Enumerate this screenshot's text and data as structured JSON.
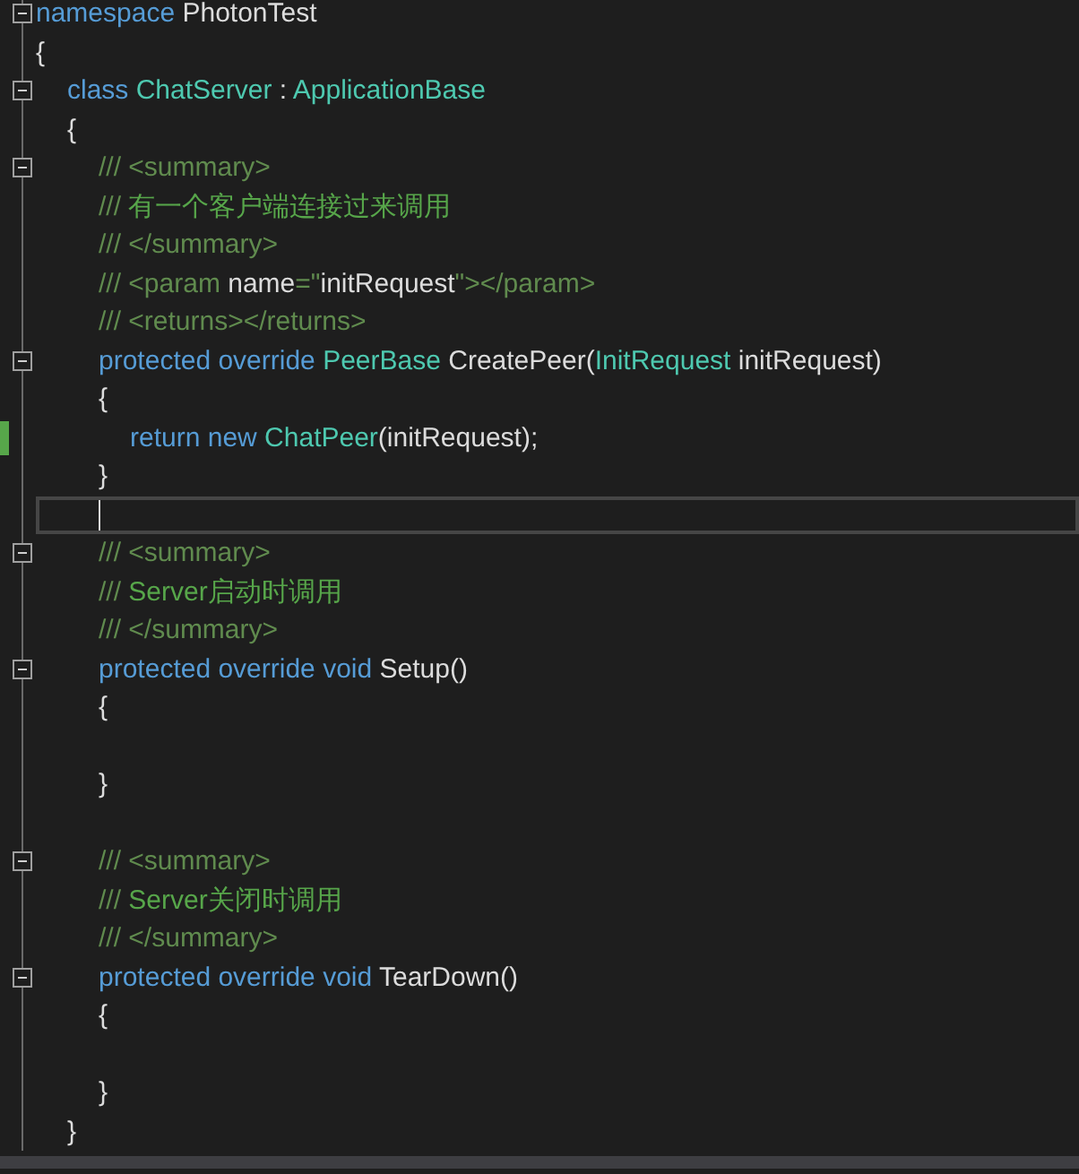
{
  "editor": {
    "lines": [
      {
        "tokens": [
          {
            "kind": "keyword",
            "text": "namespace"
          },
          {
            "kind": "plain",
            "text": " PhotonTest"
          }
        ],
        "fold": {
          "expanded": true
        },
        "changed": false,
        "current": false
      },
      {
        "tokens": [
          {
            "kind": "plain",
            "text": "{"
          }
        ],
        "changed": false,
        "current": false,
        "children": [
          {
            "tokens": [
              {
                "kind": "keyword",
                "text": "class "
              },
              {
                "kind": "type",
                "text": "ChatServer"
              },
              {
                "kind": "plain",
                "text": " : "
              },
              {
                "kind": "type",
                "text": "ApplicationBase"
              }
            ],
            "fold": {
              "expanded": true
            },
            "changed": false,
            "current": false
          },
          {
            "tokens": [
              {
                "kind": "plain",
                "text": "{"
              }
            ],
            "changed": false,
            "current": false,
            "children": [
              {
                "tokens": [
                  {
                    "kind": "doc",
                    "text": "/// <summary>"
                  }
                ],
                "fold": {
                  "expanded": true
                },
                "changed": false,
                "current": false
              },
              {
                "tokens": [
                  {
                    "kind": "doc",
                    "text": "/// "
                  },
                  {
                    "kind": "comment",
                    "text": "有一个客户端连接过来调用"
                  }
                ],
                "changed": false,
                "current": false
              },
              {
                "tokens": [
                  {
                    "kind": "doc",
                    "text": "/// </summary>"
                  }
                ],
                "changed": false,
                "current": false
              },
              {
                "tokens": [
                  {
                    "kind": "doc",
                    "text": "/// <param "
                  },
                  {
                    "kind": "plain",
                    "text": "name"
                  },
                  {
                    "kind": "doc",
                    "text": "=\""
                  },
                  {
                    "kind": "plain",
                    "text": "initRequest"
                  },
                  {
                    "kind": "doc",
                    "text": "\"></param>"
                  }
                ],
                "changed": false,
                "current": false
              },
              {
                "tokens": [
                  {
                    "kind": "doc",
                    "text": "/// <returns></returns>"
                  }
                ],
                "changed": false,
                "current": false
              },
              {
                "tokens": [
                  {
                    "kind": "keyword",
                    "text": "protected override "
                  },
                  {
                    "kind": "type",
                    "text": "PeerBase"
                  },
                  {
                    "kind": "plain",
                    "text": " CreatePeer("
                  },
                  {
                    "kind": "type",
                    "text": "InitRequest"
                  },
                  {
                    "kind": "plain",
                    "text": " initRequest)"
                  }
                ],
                "fold": {
                  "expanded": true
                },
                "changed": false,
                "current": false
              },
              {
                "tokens": [
                  {
                    "kind": "plain",
                    "text": "{"
                  }
                ],
                "changed": false,
                "current": false,
                "children": [
                  {
                    "tokens": [
                      {
                        "kind": "keyword",
                        "text": "return new "
                      },
                      {
                        "kind": "type",
                        "text": "ChatPeer"
                      },
                      {
                        "kind": "plain",
                        "text": "(initRequest);"
                      }
                    ],
                    "changed": true,
                    "current": false
                  }
                ]
              },
              {
                "tokens": [
                  {
                    "kind": "plain",
                    "text": "}"
                  }
                ],
                "changed": false,
                "current": false
              },
              {
                "changed": false,
                "current": true
              },
              {
                "tokens": [
                  {
                    "kind": "doc",
                    "text": "/// <summary>"
                  }
                ],
                "fold": {
                  "expanded": true
                },
                "changed": false,
                "current": false
              },
              {
                "tokens": [
                  {
                    "kind": "doc",
                    "text": "/// "
                  },
                  {
                    "kind": "comment",
                    "text": "Server启动时调用"
                  }
                ],
                "changed": false,
                "current": false
              },
              {
                "tokens": [
                  {
                    "kind": "doc",
                    "text": "/// </summary>"
                  }
                ],
                "changed": false,
                "current": false
              },
              {
                "tokens": [
                  {
                    "kind": "keyword",
                    "text": "protected override void"
                  },
                  {
                    "kind": "plain",
                    "text": " Setup()"
                  }
                ],
                "fold": {
                  "expanded": true
                },
                "changed": false,
                "current": false
              },
              {
                "tokens": [
                  {
                    "kind": "plain",
                    "text": "{"
                  }
                ],
                "changed": false,
                "current": false,
                "children": [
                  {
                    "changed": false,
                    "current": false
                  }
                ]
              },
              {
                "tokens": [
                  {
                    "kind": "plain",
                    "text": "}"
                  }
                ],
                "changed": false,
                "current": false
              },
              {
                "changed": false,
                "current": false
              },
              {
                "tokens": [
                  {
                    "kind": "doc",
                    "text": "/// <summary>"
                  }
                ],
                "fold": {
                  "expanded": true
                },
                "changed": false,
                "current": false
              },
              {
                "tokens": [
                  {
                    "kind": "doc",
                    "text": "/// "
                  },
                  {
                    "kind": "comment",
                    "text": "Server关闭时调用"
                  }
                ],
                "changed": false,
                "current": false
              },
              {
                "tokens": [
                  {
                    "kind": "doc",
                    "text": "/// </summary>"
                  }
                ],
                "changed": false,
                "current": false
              },
              {
                "tokens": [
                  {
                    "kind": "keyword",
                    "text": "protected override void"
                  },
                  {
                    "kind": "plain",
                    "text": " TearDown()"
                  }
                ],
                "fold": {
                  "expanded": true
                },
                "changed": false,
                "current": false
              },
              {
                "tokens": [
                  {
                    "kind": "plain",
                    "text": "{"
                  }
                ],
                "changed": false,
                "current": false,
                "children": [
                  {
                    "changed": false,
                    "current": false
                  }
                ]
              },
              {
                "tokens": [
                  {
                    "kind": "plain",
                    "text": "}"
                  }
                ],
                "changed": false,
                "current": false
              }
            ]
          },
          {
            "tokens": [
              {
                "kind": "plain",
                "text": "}"
              }
            ],
            "changed": false,
            "current": false
          }
        ]
      }
    ]
  }
}
